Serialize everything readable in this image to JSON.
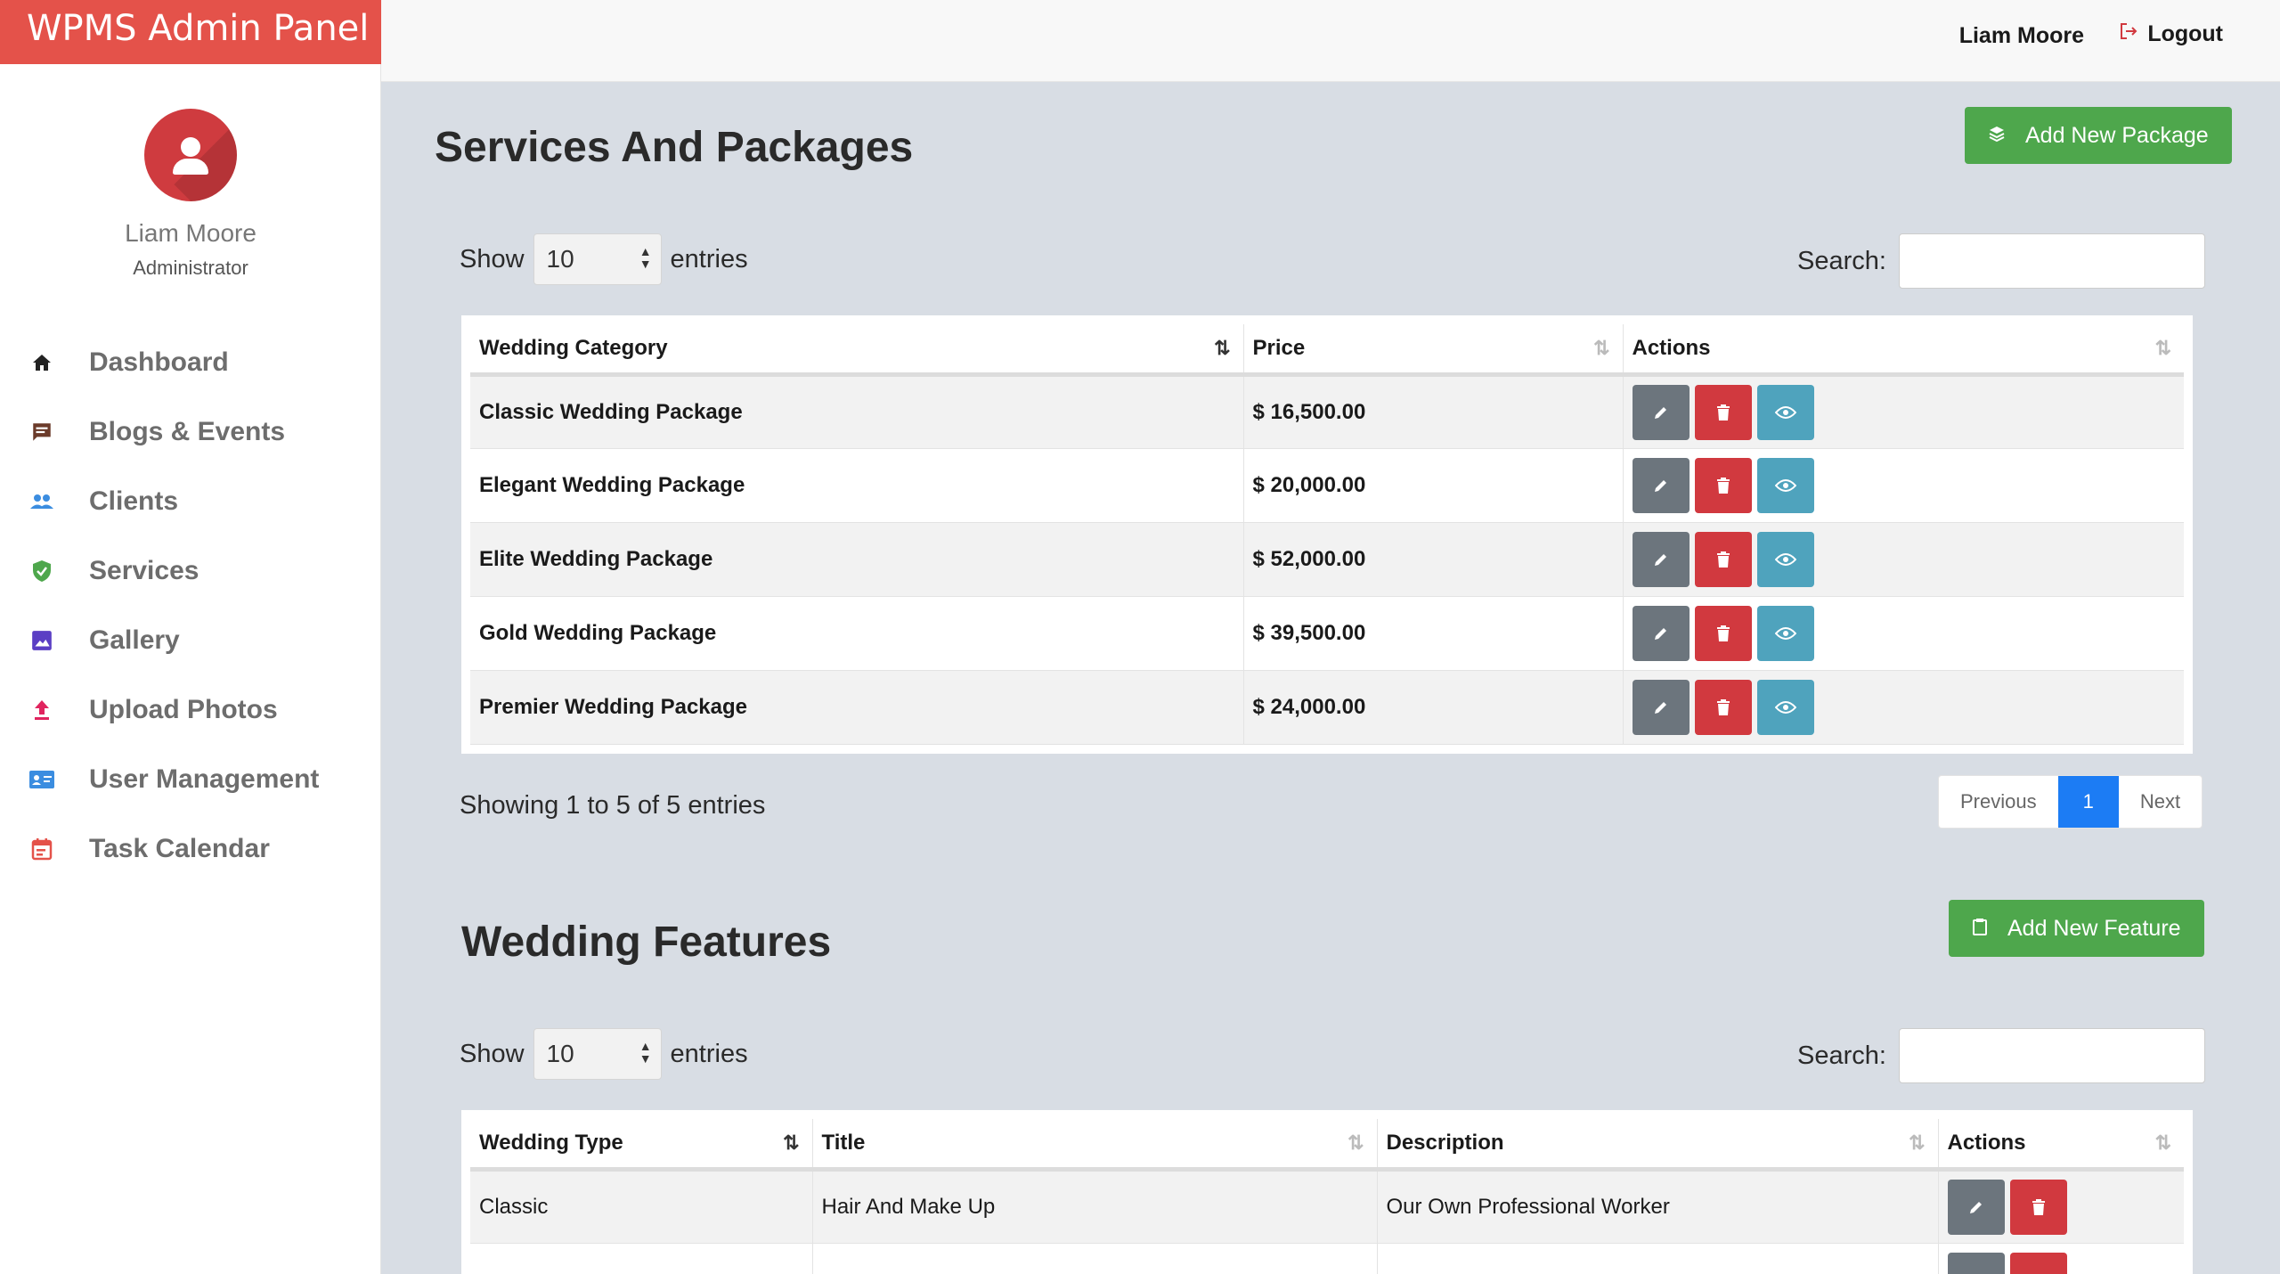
{
  "app": {
    "brand": "WPMS Admin Panel"
  },
  "profile": {
    "name": "Liam Moore",
    "role": "Administrator"
  },
  "nav": [
    {
      "label": "Dashboard",
      "icon": "home-icon",
      "color": "#222222"
    },
    {
      "label": "Blogs & Events",
      "icon": "comment-icon",
      "color": "#6b3b2a"
    },
    {
      "label": "Clients",
      "icon": "users-icon",
      "color": "#3b8de0"
    },
    {
      "label": "Services",
      "icon": "shield-check-icon",
      "color": "#4ea74c"
    },
    {
      "label": "Gallery",
      "icon": "image-icon",
      "color": "#5b3fc4"
    },
    {
      "label": "Upload Photos",
      "icon": "upload-icon",
      "color": "#e0245e"
    },
    {
      "label": "User Management",
      "icon": "id-card-icon",
      "color": "#3b8de0"
    },
    {
      "label": "Task Calendar",
      "icon": "calendar-icon",
      "color": "#e4524a"
    }
  ],
  "topbar": {
    "user": "Liam Moore",
    "logout": "Logout"
  },
  "packages": {
    "title": "Services And Packages",
    "add_button": "Add New Package",
    "show_label": "Show",
    "entries_label": "entries",
    "page_size": "10",
    "search_label": "Search:",
    "columns": [
      "Wedding Category",
      "Price",
      "Actions"
    ],
    "rows": [
      {
        "category": "Classic Wedding Package",
        "price": "$ 16,500.00"
      },
      {
        "category": "Elegant Wedding Package",
        "price": "$ 20,000.00"
      },
      {
        "category": "Elite Wedding Package",
        "price": "$ 52,000.00"
      },
      {
        "category": "Gold Wedding Package",
        "price": "$ 39,500.00"
      },
      {
        "category": "Premier Wedding Package",
        "price": "$ 24,000.00"
      }
    ],
    "info": "Showing 1 to 5 of 5 entries",
    "pager": {
      "previous": "Previous",
      "current": "1",
      "next": "Next"
    }
  },
  "features": {
    "title": "Wedding Features",
    "add_button": "Add New Feature",
    "show_label": "Show",
    "entries_label": "entries",
    "page_size": "10",
    "search_label": "Search:",
    "columns": [
      "Wedding Type",
      "Title",
      "Description",
      "Actions"
    ],
    "rows": [
      {
        "type": "Classic",
        "title": "Hair And Make Up",
        "description": "Our Own Professional Worker"
      }
    ]
  },
  "colors": {
    "brand": "#e4524a",
    "success": "#4ea74c",
    "danger": "#d1393f",
    "info": "#4fa3bd",
    "secondary": "#6c757d",
    "primary": "#1c7cf4"
  }
}
